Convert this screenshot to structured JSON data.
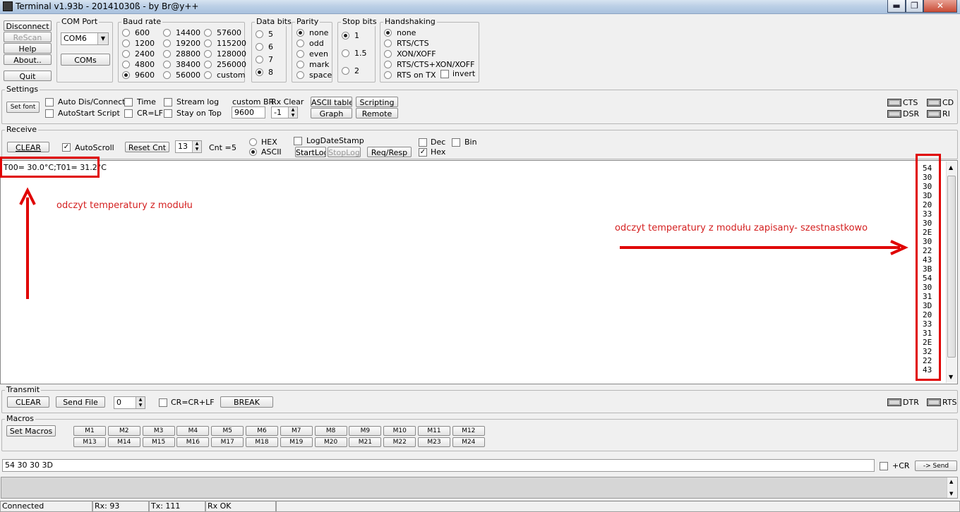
{
  "window": {
    "title": "Terminal v1.93b - 20141030ß - by Br@y++",
    "minimize": "▬",
    "maximize": "❐",
    "close": "✕"
  },
  "left_buttons": {
    "disconnect": "Disconnect",
    "rescan": "ReScan",
    "help": "Help",
    "about": "About..",
    "quit": "Quit"
  },
  "com_port": {
    "label": "COM Port",
    "value": "COM6",
    "coms": "COMs"
  },
  "baud": {
    "label": "Baud rate",
    "options": [
      "600",
      "1200",
      "2400",
      "4800",
      "9600",
      "14400",
      "19200",
      "28800",
      "38400",
      "56000",
      "57600",
      "115200",
      "128000",
      "256000",
      "custom"
    ],
    "selected": "9600"
  },
  "data_bits": {
    "label": "Data bits",
    "options": [
      "5",
      "6",
      "7",
      "8"
    ],
    "selected": "8"
  },
  "parity": {
    "label": "Parity",
    "options": [
      "none",
      "odd",
      "even",
      "mark",
      "space"
    ],
    "selected": "none"
  },
  "stop_bits": {
    "label": "Stop bits",
    "options": [
      "1",
      "1.5",
      "2"
    ],
    "selected": "1"
  },
  "handshaking": {
    "label": "Handshaking",
    "options": [
      "none",
      "RTS/CTS",
      "XON/XOFF",
      "RTS/CTS+XON/XOFF",
      "RTS on TX"
    ],
    "selected": "none",
    "invert": "invert"
  },
  "settings": {
    "label": "Settings",
    "set_font": "Set font",
    "auto_dis": "Auto Dis/Connect",
    "autostart": "AutoStart Script",
    "time": "Time",
    "crlf": "CR=LF",
    "stream_log": "Stream log",
    "stay_on_top": "Stay on Top",
    "custom_br_label": "custom BR",
    "custom_br_value": "9600",
    "rx_clear_label": "Rx Clear",
    "rx_clear_value": "-1",
    "ascii_table": "ASCII table",
    "graph": "Graph",
    "scripting": "Scripting",
    "remote": "Remote",
    "cts": "CTS",
    "dsr": "DSR",
    "cd": "CD",
    "ri": "RI"
  },
  "receive": {
    "label": "Receive",
    "clear": "CLEAR",
    "autoscroll": "AutoScroll",
    "reset_cnt": "Reset Cnt",
    "cnt_spin": "13",
    "cnt_label": "Cnt =",
    "cnt_value": "5",
    "hex": "HEX",
    "ascii": "ASCII",
    "log_date_stamp": "LogDateStamp",
    "start_log": "StartLog",
    "stop_log": "StopLog",
    "req_resp": "Req/Resp",
    "dec": "Dec",
    "bin": "Bin",
    "hexchk": "Hex",
    "text": "T00= 30.0°C;T01= 31.2°C",
    "hex_values": [
      "54",
      "30",
      "30",
      "3D",
      "20",
      "33",
      "30",
      "2E",
      "30",
      "22",
      "43",
      "3B",
      "54",
      "30",
      "31",
      "3D",
      "20",
      "33",
      "31",
      "2E",
      "32",
      "22",
      "43"
    ]
  },
  "annotations": {
    "left": "odczyt temperatury z modułu",
    "right": "odczyt temperatury z modułu zapisany- szestnastkowo",
    "red": "#d42020"
  },
  "transmit": {
    "label": "Transmit",
    "clear": "CLEAR",
    "send_file": "Send File",
    "spin": "0",
    "crcrlf": "CR=CR+LF",
    "break": "BREAK",
    "dtr": "DTR",
    "rts": "RTS"
  },
  "macros": {
    "label": "Macros",
    "set_macros": "Set Macros",
    "items": [
      "M1",
      "M2",
      "M3",
      "M4",
      "M5",
      "M6",
      "M7",
      "M8",
      "M9",
      "M10",
      "M11",
      "M12",
      "M13",
      "M14",
      "M15",
      "M16",
      "M17",
      "M18",
      "M19",
      "M20",
      "M21",
      "M22",
      "M23",
      "M24"
    ]
  },
  "send": {
    "value": "54 30 30 3D",
    "cr": "+CR",
    "send": "-> Send"
  },
  "status": {
    "connected": "Connected",
    "rx": "Rx: 93",
    "tx": "Tx: 111",
    "rxok": "Rx OK"
  }
}
